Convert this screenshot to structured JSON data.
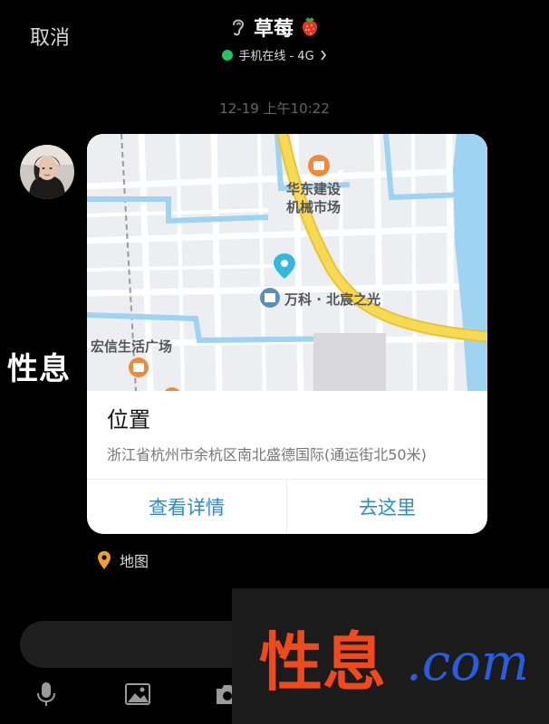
{
  "header": {
    "cancel_label": "取消",
    "title": "草莓",
    "status": "手机在线 - 4G",
    "status_color": "#21c55d"
  },
  "timestamp": "12-19 上午10:22",
  "location_card": {
    "map_labels": {
      "poi1": "华东建设",
      "poi1_line2": "机械市场",
      "poi2": "万科 · 北宸之光",
      "poi3": "宏信生活广场"
    },
    "title": "位置",
    "address": "浙江省杭州市余杭区南北盛德国际(通运街北50米)",
    "details_label": "查看详情",
    "goto_label": "去这里",
    "accent_color": "#2b8ad6"
  },
  "source": {
    "label": "地图",
    "icon": "location-pin-icon"
  },
  "toolbar": {
    "icons": [
      "microphone-icon",
      "image-icon",
      "camera-icon"
    ]
  },
  "watermark": {
    "left_text": "性息",
    "big_text": "性息",
    "big_suffix": ".com"
  }
}
